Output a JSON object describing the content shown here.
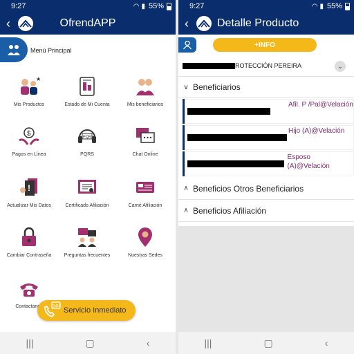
{
  "left": {
    "status": {
      "time": "9:27",
      "battery": "55%"
    },
    "appbar": {
      "title": "OfrendAPP"
    },
    "menu": {
      "title": "Menú Principal"
    },
    "tiles": [
      {
        "label": "Mis Productos",
        "icon": "people-icon"
      },
      {
        "label": "Estado de Mi Cuenta",
        "icon": "document-icon"
      },
      {
        "label": "Mis beneficiarios",
        "icon": "group-icon"
      },
      {
        "label": "Pagos en Línea",
        "icon": "money-hands-icon"
      },
      {
        "label": "PQRS",
        "icon": "pqrs-headset-icon"
      },
      {
        "label": "Chat Online",
        "icon": "chat-icon"
      },
      {
        "label": "Actualizar Mis Datos",
        "icon": "update-data-icon"
      },
      {
        "label": "Certificado Afiliación",
        "icon": "certificate-icon"
      },
      {
        "label": "Carné Afiliación",
        "icon": "id-card-icon"
      },
      {
        "label": "Cambiar Contraseña",
        "icon": "lock-icon"
      },
      {
        "label": "Preguntas frecuentes",
        "icon": "faq-icon"
      },
      {
        "label": "Nuestras Sedes",
        "icon": "location-pin-icon"
      },
      {
        "label": "Contactanos",
        "icon": "phone-icon"
      }
    ],
    "fab": {
      "label": "Servicio Inmediato",
      "badge": "24H"
    },
    "colors": {
      "primary": "#0a2d6e",
      "accent": "#f5b81a",
      "icon": "#a3306e"
    }
  },
  "right": {
    "status": {
      "time": "9:27",
      "battery": "55%"
    },
    "appbar": {
      "title": "Detalle Producto"
    },
    "info_button": "+INFO",
    "plan_suffix": "ROTECCIÓN PEREIRA",
    "sections": {
      "beneficiarios": "Beneficiarios",
      "otros": "Beneficios Otros Beneficiarios",
      "afiliacion": "Beneficios Afiliación"
    },
    "beneficiaries": [
      {
        "relation": "Afil. P /Pal@Velación"
      },
      {
        "relation": "Hijo (A)@Velación"
      },
      {
        "relation": "Esposo (A)@Velación"
      }
    ]
  }
}
